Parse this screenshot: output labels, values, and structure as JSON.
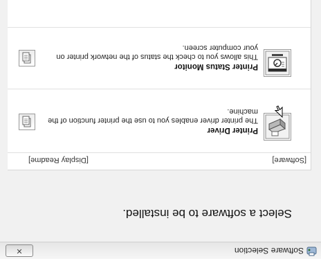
{
  "window": {
    "title": "Software Selection",
    "close_label": "✕"
  },
  "heading": "Select a software to be installed.",
  "columns": {
    "software": "[Software]",
    "readme": "[Display Readme]"
  },
  "items": [
    {
      "title": "Printer Driver",
      "description": "The printer driver enables you to use the printer function of the machine.",
      "icon": "printer-icon"
    },
    {
      "title": "Printer Status Monitor",
      "description": "This allows you to check the status of the network printer on your computer screen.",
      "icon": "status-monitor-icon"
    }
  ],
  "readme_icon": "document-icon",
  "cursor_icon": "mouse-pointer-icon"
}
